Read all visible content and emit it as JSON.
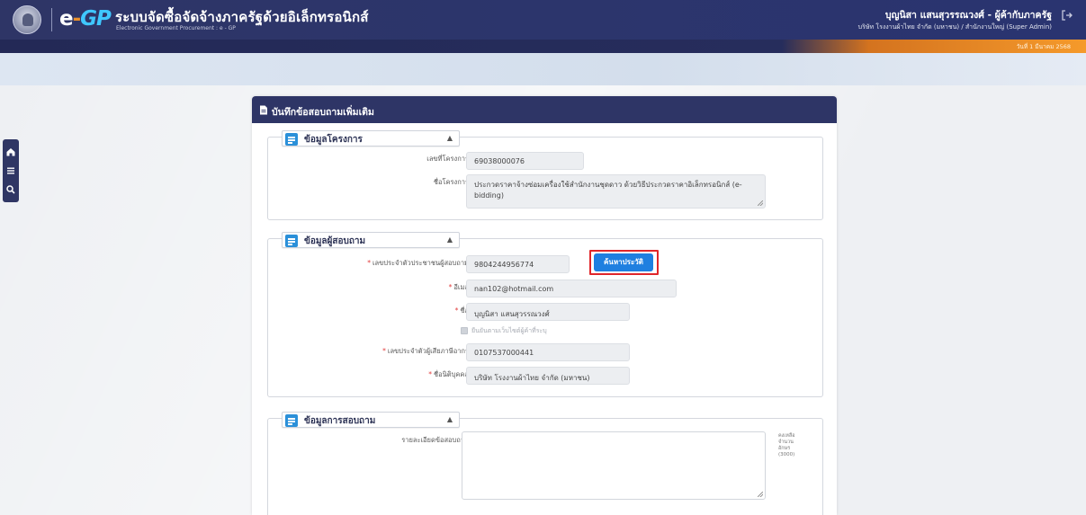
{
  "header": {
    "logo_e": "e",
    "logo_dash": "-",
    "logo_gp": "GP",
    "system_title": "ระบบจัดซื้อจัดจ้างภาครัฐด้วยอิเล็กทรอนิกส์",
    "system_subtitle": "Electronic Government Procurement : e - GP",
    "user_name": "บุญนิสา แสนสุวรรณวงศ์ - ผู้ค้ากับภาครัฐ",
    "user_org": "บริษัท โรงงานผ้าไทย จำกัด (มหาชน) / สำนักงานใหญ่ (Super Admin)",
    "date_text": "วันที่ 1 มีนาคม 2568"
  },
  "sidenav": {
    "icons": [
      "home-icon",
      "menu-icon",
      "search-icon"
    ]
  },
  "page": {
    "title": "บันทึกข้อสอบถามเพิ่มเติม"
  },
  "project_section": {
    "title": "ข้อมูลโครงการ",
    "project_no_label": "เลขที่โครงการ",
    "project_no": "69038000076",
    "project_name_label": "ชื่อโครงการ",
    "project_name": "ประกวดราคาจ้างซ่อมเครื่องใช้สำนักงานชุดดาว ด้วยวิธีประกวดราคาอิเล็กทรอนิกส์ (e-bidding)"
  },
  "inquirer_section": {
    "title": "ข้อมูลผู้สอบถาม",
    "id_label": "เลขประจำตัวประชาชนผู้สอบถาม",
    "id_value": "9804244956774",
    "history_button": "ค้นหาประวัติ",
    "email_label": "อีเมล",
    "email_value": "nan102@hotmail.com",
    "name_label": "ชื่อ",
    "name_value": "บุญนิสา แสนสุวรรณวงศ์",
    "checkbox_label": "ยืนยันตามเว็บไซต์ผู้ค้าที่ระบุ",
    "tax_label": "เลขประจำตัวผู้เสียภาษีอากร",
    "tax_value": "0107537000441",
    "company_label": "ชื่อนิติบุคคล",
    "company_value": "บริษัท โรงงานผ้าไทย จำกัด (มหาชน)"
  },
  "question_section": {
    "title": "ข้อมูลการสอบถาม",
    "detail_label": "รายละเอียดข้อสอบถาม",
    "detail_value": "",
    "counter_line1": "คงเหลือจำนวน",
    "counter_line2": "อักษร",
    "counter_value": "(3000)"
  },
  "colors": {
    "header_bg": "#2e3566",
    "accent_orange": "#f59a2b",
    "button_blue": "#1f7fe0",
    "highlight_red": "#e0262a",
    "section_icon_blue": "#2b90d9"
  }
}
